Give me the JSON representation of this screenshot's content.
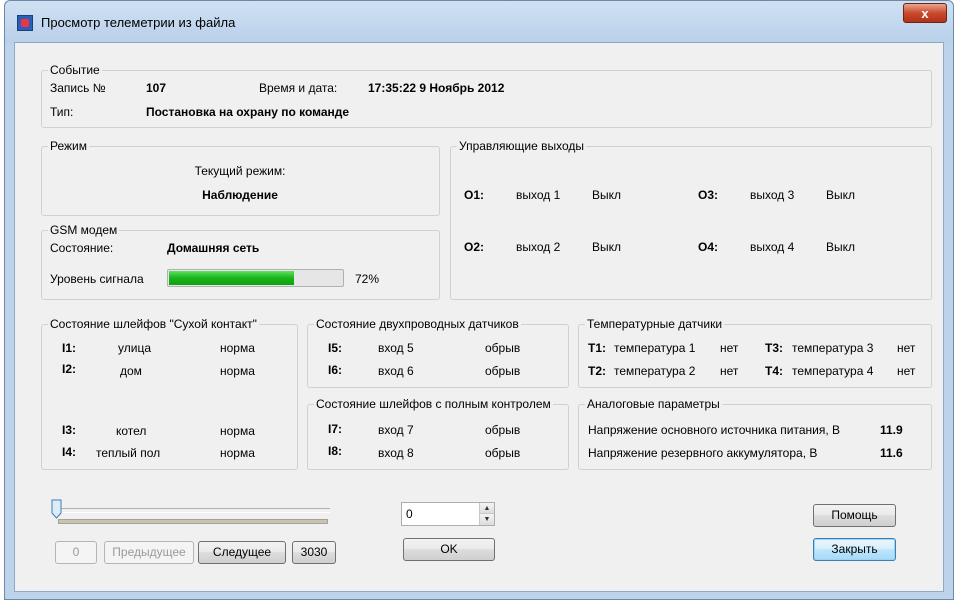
{
  "window": {
    "title": "Просмотр телеметрии из файла",
    "close_label": "x"
  },
  "event": {
    "group_title": "Событие",
    "record_label": "Запись №",
    "record_value": "107",
    "datetime_label": "Время и дата:",
    "datetime_value": "17:35:22  9 Ноябрь 2012",
    "type_label": "Тип:",
    "type_value": "Постановка на охрану по команде"
  },
  "mode": {
    "group_title": "Режим",
    "current_label": "Текущий режим:",
    "current_value": "Наблюдение"
  },
  "gsm": {
    "group_title": "GSM модем",
    "state_label": "Состояние:",
    "state_value": "Домашняя сеть",
    "signal_label": "Уровень сигнала",
    "signal_fraction": 0.72,
    "signal_text": "72%",
    "bar_color": "#19b519"
  },
  "outputs": {
    "group_title": "Управляющие выходы",
    "items": [
      {
        "id": "O1:",
        "name": "выход 1",
        "state": "Выкл"
      },
      {
        "id": "O2:",
        "name": "выход 2",
        "state": "Выкл"
      },
      {
        "id": "O3:",
        "name": "выход 3",
        "state": "Выкл"
      },
      {
        "id": "O4:",
        "name": "выход 4",
        "state": "Выкл"
      }
    ]
  },
  "dry_contact": {
    "group_title": "Состояние шлейфов \"Сухой контакт\"",
    "items": [
      {
        "id": "I1:",
        "name": "улица",
        "state": "норма"
      },
      {
        "id": "I2:",
        "name": "дом",
        "state": "норма"
      },
      {
        "id": "I3:",
        "name": "котел",
        "state": "норма"
      },
      {
        "id": "I4:",
        "name": "теплый пол",
        "state": "норма"
      }
    ]
  },
  "two_wire": {
    "group_title": "Состояние двухпроводных датчиков",
    "items": [
      {
        "id": "I5:",
        "name": "вход 5",
        "state": "обрыв"
      },
      {
        "id": "I6:",
        "name": "вход 6",
        "state": "обрыв"
      }
    ]
  },
  "full_control": {
    "group_title": "Состояние шлейфов с полным контролем",
    "items": [
      {
        "id": "I7:",
        "name": "вход 7",
        "state": "обрыв"
      },
      {
        "id": "I8:",
        "name": "вход 8",
        "state": "обрыв"
      }
    ]
  },
  "temperature": {
    "group_title": "Температурные датчики",
    "items": [
      {
        "id": "T1:",
        "name": "температура 1",
        "state": "нет"
      },
      {
        "id": "T2:",
        "name": "температура 2",
        "state": "нет"
      },
      {
        "id": "T3:",
        "name": "температура 3",
        "state": "нет"
      },
      {
        "id": "T4:",
        "name": "температура 4",
        "state": "нет"
      }
    ]
  },
  "analog": {
    "group_title": "Аналоговые параметры",
    "items": [
      {
        "name": "Напряжение основного источника питания, В",
        "value": "11.9"
      },
      {
        "name": "Напряжение резервного аккумулятора, В",
        "value": "11.6"
      }
    ]
  },
  "navigation": {
    "slider_position": 0,
    "min_label": "0",
    "prev_label": "Предыдущее",
    "next_label": "Следущее",
    "max_label": "3030",
    "spin_value": "0",
    "ok_label": "OK",
    "help_label": "Помощь",
    "close_label": "Закрыть"
  }
}
